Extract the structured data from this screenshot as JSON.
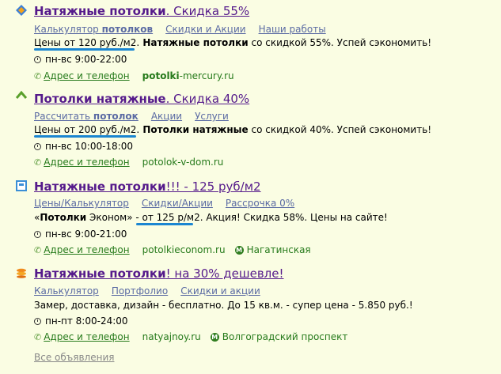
{
  "ads": [
    {
      "icon": "diamond-logo-icon",
      "title_bold": "Натяжные потолки",
      "title_rest": ". Скидка 55%",
      "sitelinks": [
        {
          "pre": "Калькулятор ",
          "bold": "потолков",
          "post": ""
        },
        {
          "pre": "Скидки и Акции",
          "bold": "",
          "post": ""
        },
        {
          "pre": "Наши работы",
          "bold": "",
          "post": ""
        }
      ],
      "desc_pre": "Цены от 120 руб./м2.",
      "desc_bold": " Натяжные потолки",
      "desc_rest": " со скидкой 55%. Успей сэкономить!",
      "hours": "пн-вс 9:00-22:00",
      "address_link": "Адрес и телефон",
      "domain_bold": "potolki",
      "domain_rest": "-mercury.ru",
      "metro": ""
    },
    {
      "icon": "roof-logo-icon",
      "title_bold": "Потолки натяжные",
      "title_rest": ". Скидка 40%",
      "sitelinks": [
        {
          "pre": "Рассчитать ",
          "bold": "потолок",
          "post": ""
        },
        {
          "pre": "Акции",
          "bold": "",
          "post": ""
        },
        {
          "pre": "Услуги",
          "bold": "",
          "post": ""
        }
      ],
      "desc_pre": "Цены от 200 руб./м2.",
      "desc_bold": " Потолки натяжные",
      "desc_rest": " со скидкой 40%. Успей сэкономить!",
      "hours": "пн-вс 10:00-18:00",
      "address_link": "Адрес и телефон",
      "domain_bold": "",
      "domain_rest": "potolok-v-dom.ru",
      "metro": ""
    },
    {
      "icon": "square-logo-icon",
      "title_bold": "Натяжные потолки",
      "title_rest": "!!! - 125 руб/м2",
      "sitelinks": [
        {
          "pre": "Цены/Калькулятор",
          "bold": "",
          "post": ""
        },
        {
          "pre": "Скидки/Акции",
          "bold": "",
          "post": ""
        },
        {
          "pre": "Рассрочка 0%",
          "bold": "",
          "post": ""
        }
      ],
      "desc_lead": "«",
      "desc_bold": "Потолки",
      "desc_mid": " Эконом» - ",
      "desc_pre": "от 125 р/м2",
      "desc_rest": ". Акция! Скидка 58%. Цены на сайте!",
      "hours": "пн-вс 9:00-21:00",
      "address_link": "Адрес и телефон",
      "domain_bold": "",
      "domain_rest": "potolkieconom.ru",
      "metro": "Нагатинская"
    },
    {
      "icon": "stack-logo-icon",
      "title_bold": "Натяжные потолки",
      "title_rest": "! на 30% дешевле!",
      "sitelinks": [
        {
          "pre": "Калькулятор",
          "bold": "",
          "post": ""
        },
        {
          "pre": "Портфолио",
          "bold": "",
          "post": ""
        },
        {
          "pre": "Скидки и акции",
          "bold": "",
          "post": ""
        }
      ],
      "desc_plain": "Замер, доставка, дизайн - бесплатно. До 15 кв.м. - супер цена - 5.850 руб.!",
      "hours": "пн-пт 8:00-24:00",
      "address_link": "Адрес и телефон",
      "domain_bold": "",
      "domain_rest": "natyajnoy.ru",
      "metro": "Волгоградский проспект"
    }
  ],
  "all_ads_link": "Все объявления",
  "metro_symbol": "М",
  "colors": {
    "background": "#fafde3",
    "title": "#551a8b",
    "link": "#5a6aa3",
    "green": "#267a1b",
    "underline": "#1b86d1"
  }
}
